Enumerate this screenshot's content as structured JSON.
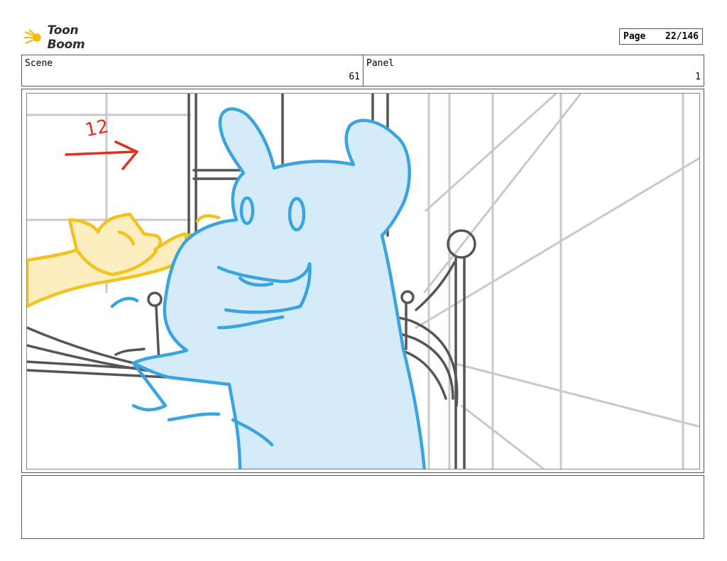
{
  "header": {
    "logo_text": "Toon Boom",
    "page_label": "Page",
    "page_value": "22/146"
  },
  "scene": {
    "label": "Scene",
    "value": "61"
  },
  "panel": {
    "label": "Panel",
    "value": "1"
  },
  "sketch": {
    "annotation_number": "12",
    "colors": {
      "grey_lines": "#c9c9c9",
      "dark_lines": "#555555",
      "blue_stroke": "#3aa3e0",
      "blue_fill": "#d4ecf9",
      "yellow_stroke": "#f4c21e",
      "yellow_fill": "#fdeec0",
      "red_annotation": "#e0301c",
      "logo_accent": "#f5b800"
    }
  },
  "notes": {
    "text": ""
  }
}
